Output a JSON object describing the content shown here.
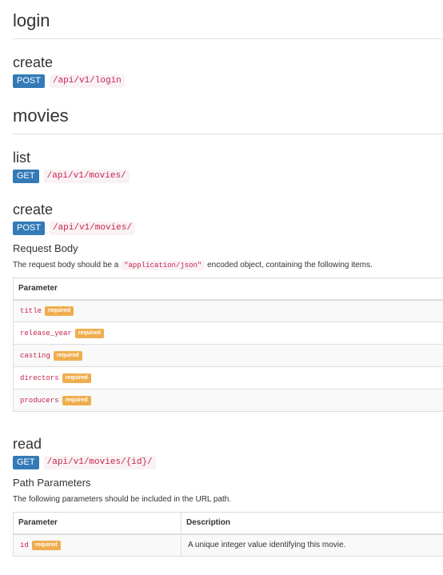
{
  "sections": {
    "login": {
      "title": "login",
      "create": {
        "title": "create",
        "method": "POST",
        "path": "/api/v1/login"
      }
    },
    "movies": {
      "title": "movies",
      "list": {
        "title": "list",
        "method": "GET",
        "path": "/api/v1/movies/"
      },
      "create": {
        "title": "create",
        "method": "POST",
        "path": "/api/v1/movies/",
        "body_heading": "Request Body",
        "body_desc_prefix": "The request body should be a",
        "body_desc_code": "\"application/json\"",
        "body_desc_suffix": "encoded object, containing the following items.",
        "table_header": "Parameter",
        "required_label": "required",
        "params": [
          "title",
          "release_year",
          "casting",
          "directors",
          "producers"
        ]
      },
      "read": {
        "title": "read",
        "method": "GET",
        "path": "/api/v1/movies/{id}/",
        "path_heading": "Path Parameters",
        "path_desc": "The following parameters should be included in the URL path.",
        "col_parameter": "Parameter",
        "col_description": "Description",
        "param_name": "id",
        "required_label": "required",
        "param_description": "A unique integer value identifying this movie."
      }
    }
  }
}
